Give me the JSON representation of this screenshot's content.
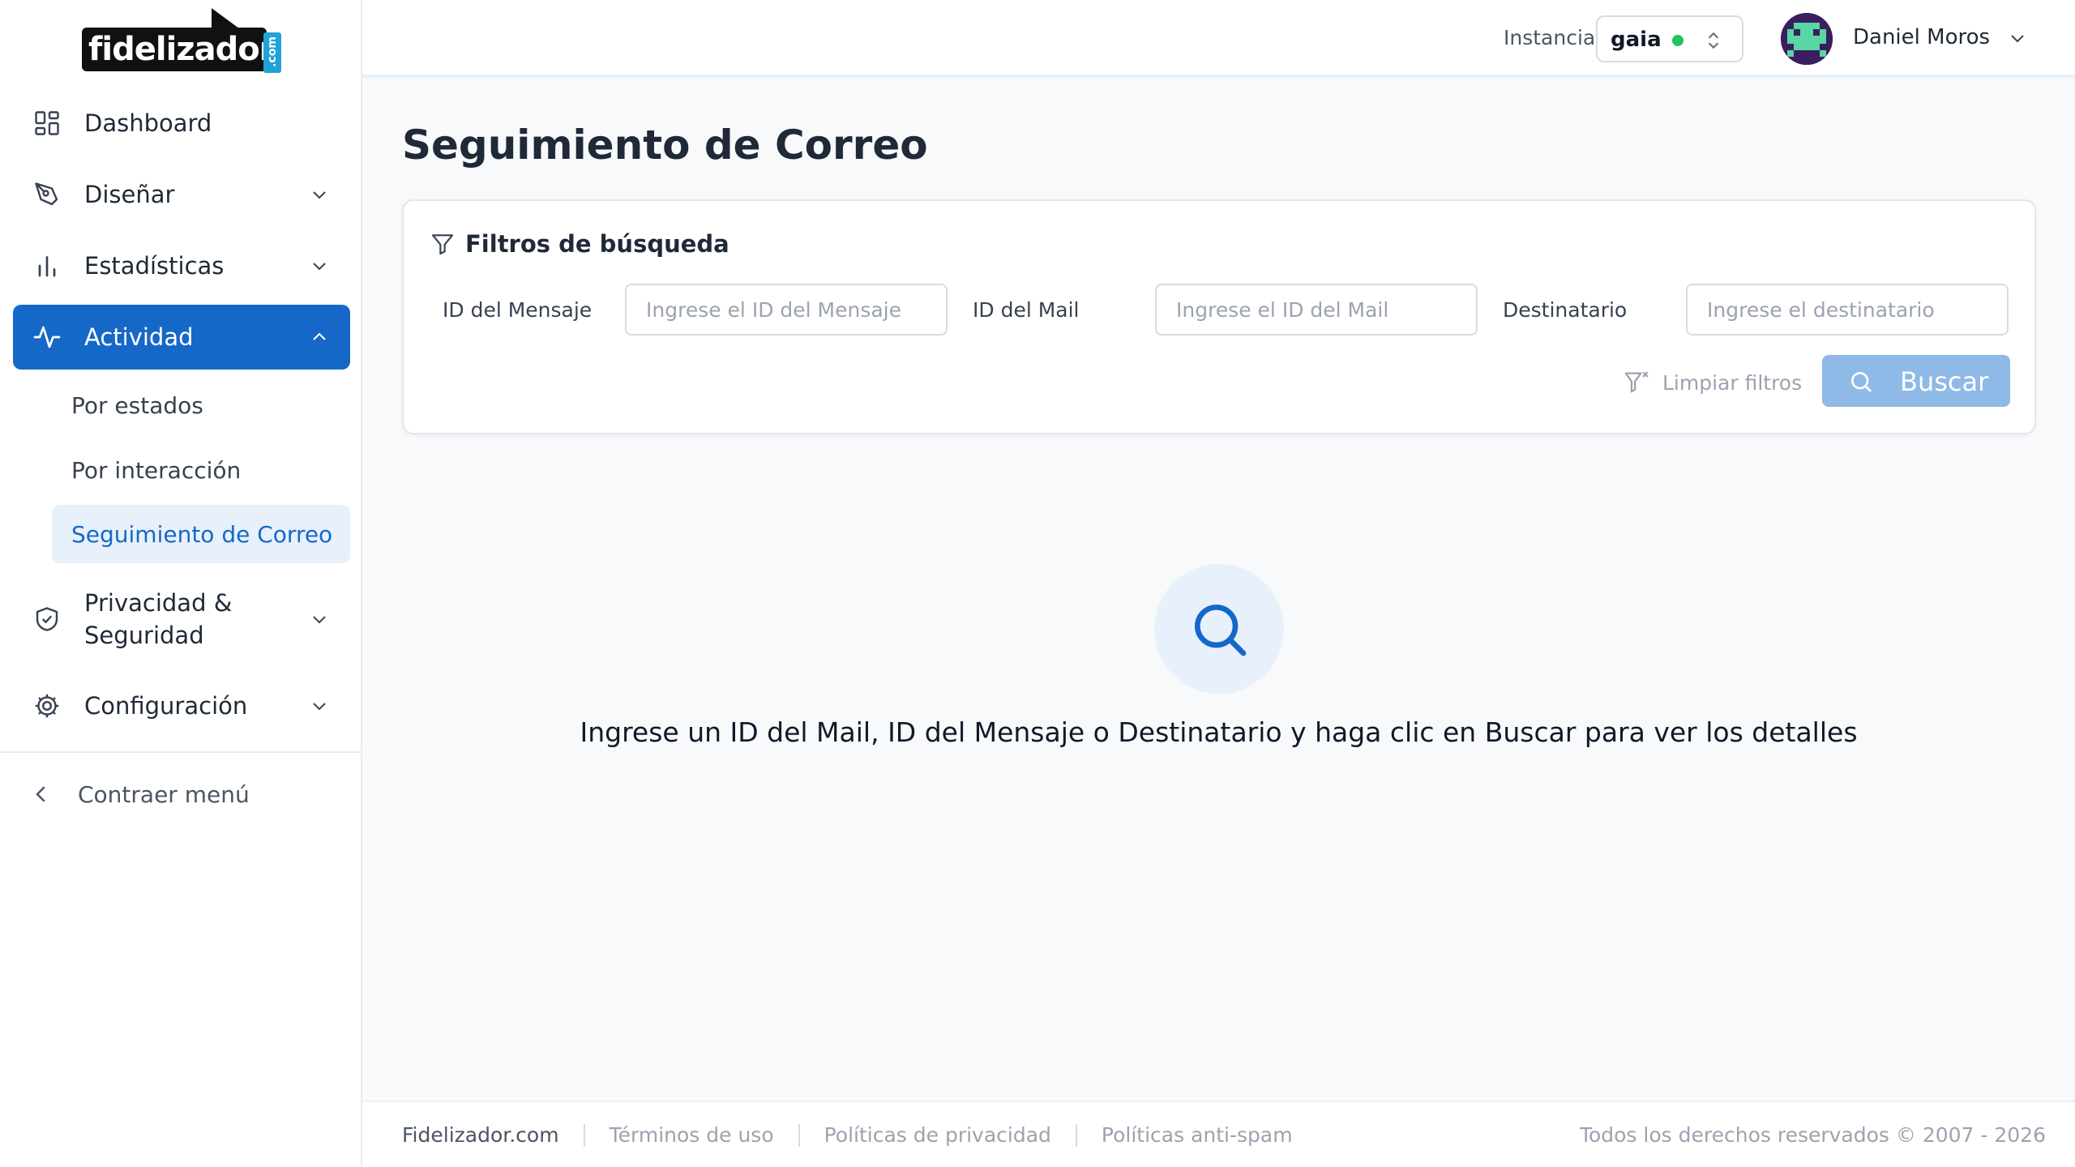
{
  "brand": {
    "logo_text": "fidelizador",
    "logo_suffix": ".com"
  },
  "header": {
    "instance_label": "Instancia",
    "instance_value": "gaia",
    "instance_status_color": "#22c55e",
    "user_name": "Daniel Moros"
  },
  "sidebar": {
    "items": [
      {
        "label": "Dashboard",
        "icon": "dashboard-grid-icon"
      },
      {
        "label": "Diseñar",
        "icon": "pen-tool-icon"
      },
      {
        "label": "Estadísticas",
        "icon": "bar-chart-icon"
      },
      {
        "label": "Actividad",
        "icon": "activity-pulse-icon",
        "active": true
      },
      {
        "label": "Privacidad & Seguridad",
        "icon": "shield-check-icon"
      },
      {
        "label": "Configuración",
        "icon": "gear-icon"
      }
    ],
    "sub_items": [
      {
        "label": "Por estados"
      },
      {
        "label": "Por interacción"
      },
      {
        "label": "Seguimiento de Correo",
        "active": true
      }
    ],
    "collapse_label": "Contraer menú"
  },
  "main": {
    "title": "Seguimiento de Correo",
    "filters": {
      "heading": "Filtros de búsqueda",
      "fields": [
        {
          "label": "ID del Mensaje",
          "placeholder": "Ingrese el ID del Mensaje",
          "value": ""
        },
        {
          "label": "ID del Mail",
          "placeholder": "Ingrese el ID del Mail",
          "value": ""
        },
        {
          "label": "Destinatario",
          "placeholder": "Ingrese el destinatario",
          "value": ""
        }
      ],
      "clear_label": "Limpiar filtros",
      "search_label": "Buscar"
    },
    "empty_message": "Ingrese un ID del Mail, ID del Mensaje o Destinatario y haga clic en Buscar para ver los detalles"
  },
  "footer": {
    "links": [
      "Fidelizador.com",
      "Términos de uso",
      "Políticas de privacidad",
      "Políticas anti-spam"
    ],
    "copyright": "Todos los derechos reservados © 2007 - 2026"
  },
  "colors": {
    "primary": "#1668c8",
    "primary_light": "#8fb9e6",
    "active_sub_bg": "#e7f0fb"
  }
}
